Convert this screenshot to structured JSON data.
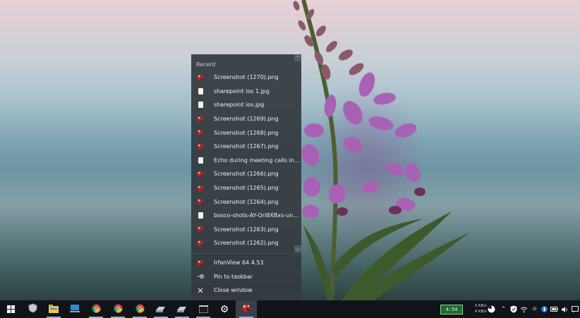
{
  "jump_list": {
    "section_title": "Recent",
    "recent_items": [
      {
        "label": "Screenshot (1270).png",
        "icon": "irfanview-file-icon"
      },
      {
        "label": "sharepoint ios 1.jpg",
        "icon": "document-icon"
      },
      {
        "label": "sharepoint ios.jpg",
        "icon": "document-icon"
      },
      {
        "label": "Screenshot (1269).png",
        "icon": "irfanview-file-icon"
      },
      {
        "label": "Screenshot (1268).png",
        "icon": "irfanview-file-icon"
      },
      {
        "label": "Screenshot (1267).png",
        "icon": "irfanview-file-icon"
      },
      {
        "label": "Echo during meeting calls in Micros...",
        "icon": "document-icon"
      },
      {
        "label": "Screenshot (1266).png",
        "icon": "irfanview-file-icon"
      },
      {
        "label": "Screenshot (1265).png",
        "icon": "irfanview-file-icon"
      },
      {
        "label": "Screenshot (1264).png",
        "icon": "irfanview-file-icon"
      },
      {
        "label": "bosco-shots-AY-Ori8XBxs-unsplash....",
        "icon": "document-icon"
      },
      {
        "label": "Screenshot (1263).png",
        "icon": "irfanview-file-icon"
      },
      {
        "label": "Screenshot (1262).png",
        "icon": "irfanview-file-icon"
      }
    ],
    "actions": {
      "app_name": "IrfanView 64 4.53",
      "pin": "Pin to taskbar",
      "close": "Close window"
    }
  },
  "taskbar": {
    "apps": [
      {
        "name": "start-button",
        "icon": "windows-logo-icon"
      },
      {
        "name": "taskbar-security-app",
        "icon": "shield-icon"
      },
      {
        "name": "taskbar-file-explorer",
        "icon": "folder-icon"
      },
      {
        "name": "taskbar-this-pc",
        "icon": "computer-icon"
      },
      {
        "name": "taskbar-chrome-1",
        "icon": "chrome-icon"
      },
      {
        "name": "taskbar-chrome-2",
        "icon": "chrome-icon"
      },
      {
        "name": "taskbar-chrome-3",
        "icon": "chrome-icon"
      },
      {
        "name": "taskbar-drive-1",
        "icon": "drive-icon"
      },
      {
        "name": "taskbar-drive-2",
        "icon": "drive-icon"
      },
      {
        "name": "taskbar-terminal",
        "icon": "terminal-icon"
      },
      {
        "name": "taskbar-settings",
        "icon": "gear-icon"
      },
      {
        "name": "taskbar-irfanview",
        "icon": "irfanview-icon"
      }
    ],
    "battery_meter": "4:54",
    "net_up": "3 KB/s",
    "net_down": "4 KB/s"
  },
  "colors": {
    "menu_bg": "#343a40",
    "taskbar_bg": "#101418",
    "accent": "#7fb2e6",
    "battery_green": "#1d6b2d"
  }
}
